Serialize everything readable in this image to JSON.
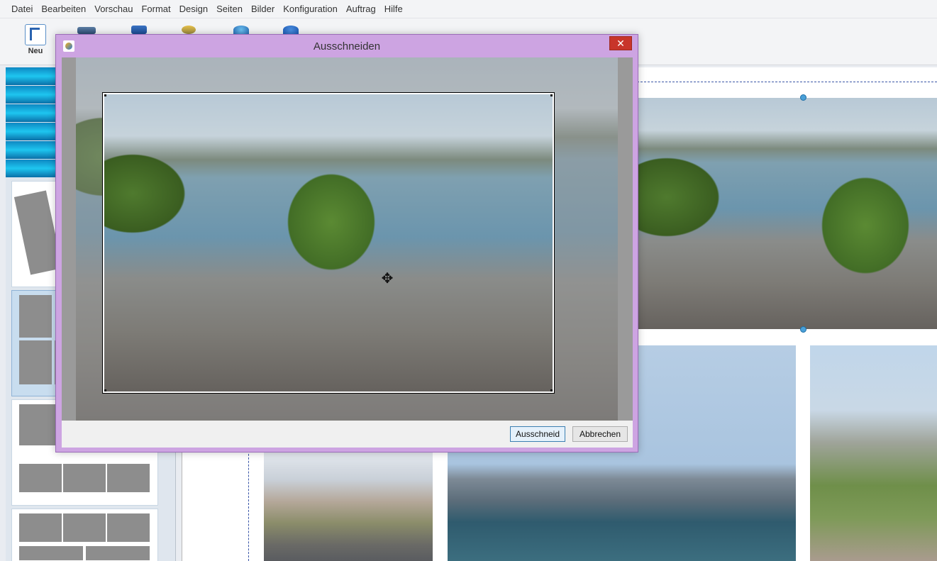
{
  "menu": [
    "Datei",
    "Bearbeiten",
    "Vorschau",
    "Format",
    "Design",
    "Seiten",
    "Bilder",
    "Konfiguration",
    "Auftrag",
    "Hilfe"
  ],
  "toolbar": {
    "new_label": "Neu",
    "icons": [
      "new-document-icon",
      "open-icon",
      "save-icon",
      "print-icon",
      "internet-icon",
      "help-icon"
    ]
  },
  "dialog": {
    "title": "Ausschneiden",
    "close_symbol": "✕",
    "ok_label": "Ausschneid",
    "cancel_label": "Abbrechen",
    "move_symbol": "✥"
  },
  "colors": {
    "dialog_border": "#cda4e2",
    "close_button": "#c8352a",
    "accent_stripes": "#1ec6f0"
  }
}
